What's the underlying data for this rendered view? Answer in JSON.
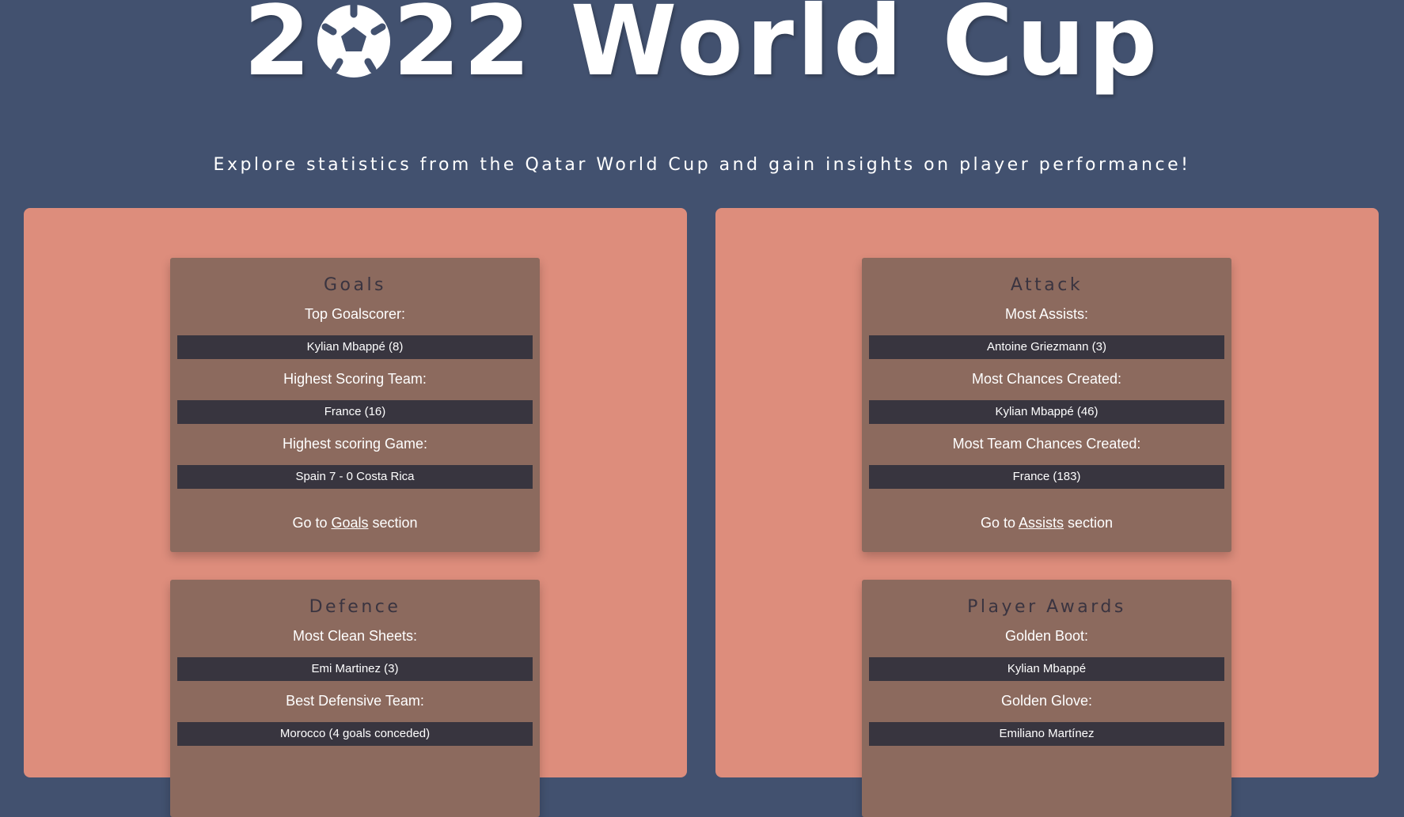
{
  "hero": {
    "title_prefix": "2",
    "title_suffix": "22 World Cup",
    "ball_icon": "soccer-ball-icon"
  },
  "subtitle": "Explore statistics from the Qatar World Cup and gain insights on player performance!",
  "colors": {
    "background": "#42516f",
    "panel": "#dd8d7c",
    "card": "#8c6a5e",
    "value_box": "#38353f",
    "card_title": "#3a3440"
  },
  "cards": {
    "goals": {
      "title": "Goals",
      "stats": [
        {
          "label": "Top Goalscorer:",
          "value": "Kylian Mbappé (8)"
        },
        {
          "label": "Highest Scoring Team:",
          "value": "France (16)"
        },
        {
          "label": "Highest scoring Game:",
          "value": "Spain 7 - 0 Costa Rica"
        }
      ],
      "goto_prefix": "Go to ",
      "goto_link": "Goals",
      "goto_suffix": " section"
    },
    "attack": {
      "title": "Attack",
      "stats": [
        {
          "label": "Most Assists:",
          "value": "Antoine Griezmann (3)"
        },
        {
          "label": "Most Chances Created:",
          "value": "Kylian Mbappé (46)"
        },
        {
          "label": "Most Team Chances Created:",
          "value": "France (183)"
        }
      ],
      "goto_prefix": "Go to ",
      "goto_link": "Assists",
      "goto_suffix": " section"
    },
    "defence": {
      "title": "Defence",
      "stats": [
        {
          "label": "Most Clean Sheets:",
          "value": "Emi Martinez (3)"
        },
        {
          "label": "Best Defensive Team:",
          "value": "Morocco (4 goals conceded)"
        }
      ]
    },
    "awards": {
      "title": "Player Awards",
      "stats": [
        {
          "label": "Golden Boot:",
          "value": "Kylian Mbappé"
        },
        {
          "label": "Golden Glove:",
          "value": "Emiliano Martínez"
        }
      ]
    }
  }
}
